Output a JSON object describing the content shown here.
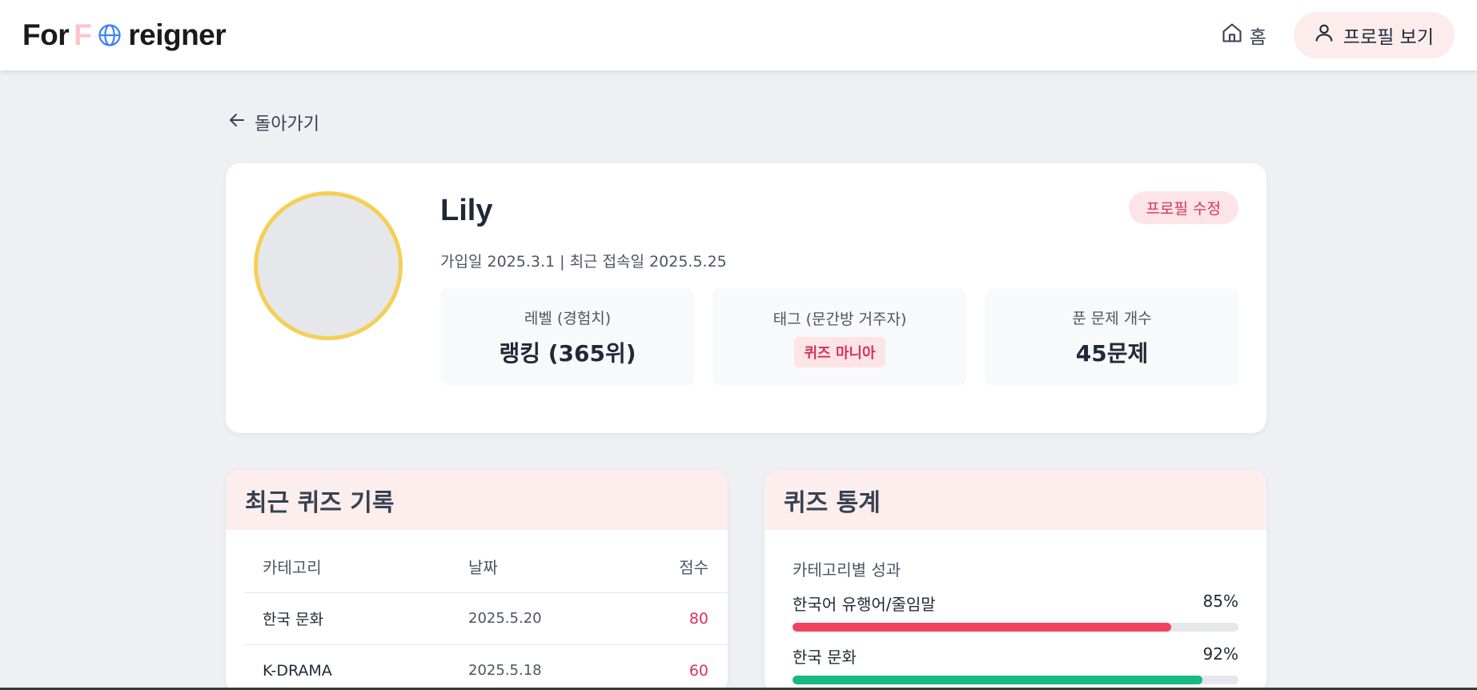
{
  "header": {
    "logo_prefix": "For",
    "logo_f": "F",
    "logo_suffix": "reigner",
    "home_label": "홈",
    "profile_label": "프로필 보기"
  },
  "back_label": "돌아가기",
  "profile": {
    "name": "Lily",
    "edit_label": "프로필 수정",
    "join_text": "가입일 2025.3.1 | 최근 접속일 2025.5.25",
    "stats": [
      {
        "label": "레벨 (경험치)",
        "value": "랭킹 (365위)"
      },
      {
        "label": "태그 (문간방 거주자)",
        "value": "퀴즈 마니아"
      },
      {
        "label": "푼 문제 개수",
        "value": "45문제"
      }
    ]
  },
  "recent": {
    "title": "최근 퀴즈 기록",
    "columns": [
      "카테고리",
      "날짜",
      "점수"
    ],
    "rows": [
      {
        "category": "한국 문화",
        "date": "2025.5.20",
        "score": "80"
      },
      {
        "category": "K-DRAMA",
        "date": "2025.5.18",
        "score": "60"
      }
    ]
  },
  "stats_panel": {
    "title": "퀴즈 통계",
    "subtitle": "카테고리별 성과",
    "bars": [
      {
        "label": "한국어 유행어/줄임말",
        "percent_text": "85%",
        "value": 0.85,
        "color": "#f0435f"
      },
      {
        "label": "한국 문화",
        "percent_text": "92%",
        "value": 0.92,
        "color": "#16b981"
      }
    ]
  },
  "colors": {
    "accent_pink": "#d6335c",
    "avatar_ring": "#f5cf55",
    "globe_blue": "#3b82f6"
  }
}
